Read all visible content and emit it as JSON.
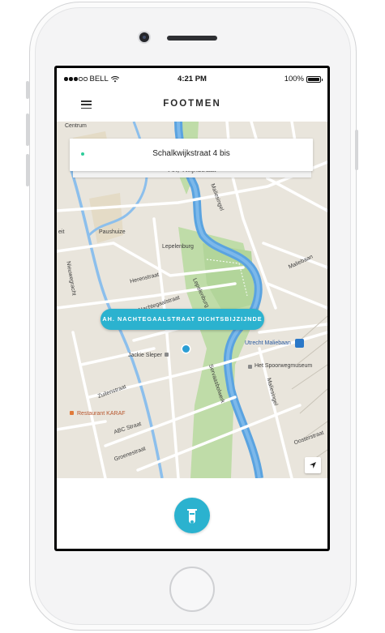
{
  "status_bar": {
    "carrier": "BELL",
    "time": "4:21 PM",
    "battery": "100%"
  },
  "header": {
    "title": "FOOTMEN",
    "menu_icon": "hamburger-icon"
  },
  "route": {
    "from": "Schalkwijkstraat 4 bis",
    "to": "Ah, Twijnstraat",
    "from_color": "#2ecc9a",
    "to_color": "#e8505b"
  },
  "pickup": {
    "label": "AH. NACHTEGAALSTRAAT DICHTSBIJZIJNDE"
  },
  "map": {
    "labels": {
      "centrum": "Centrum",
      "paushuize": "Paushuize",
      "lepelenburg": "Lepelenburg",
      "herenstraat": "Herenstraat",
      "nieuwegracht": "Nieuwegracht",
      "jackie_sleper": "Jackie Sleper",
      "zuilenstraat": "Zuilenstraat",
      "restaurant_karaf": "Restaurant KARAF",
      "abc_straat": "ABC Straat",
      "groenestraat": "Groenestraat",
      "maliesingel": "Maliesingel",
      "maliesingel_2": "Maliesingel",
      "maliebaan": "Maliebaan",
      "utrecht_maliebaan": "Utrecht Maliebaan",
      "spoorwegmuseum": "Het Spoorwegmuseum",
      "servaasbolwerk": "Servaasbolwerk",
      "oosterstraat": "Oosterstraat",
      "eit": "eit",
      "lepelenburg_road": "Lepelenburg",
      "nachtegaalstraat": "Nachtegaalstraat"
    }
  },
  "colors": {
    "accent": "#2bb2cf",
    "water": "#5aa3e0",
    "park": "#bfdca8",
    "map_bg": "#e9e5dc"
  },
  "bottom": {
    "button_icon": "scooter-icon"
  }
}
